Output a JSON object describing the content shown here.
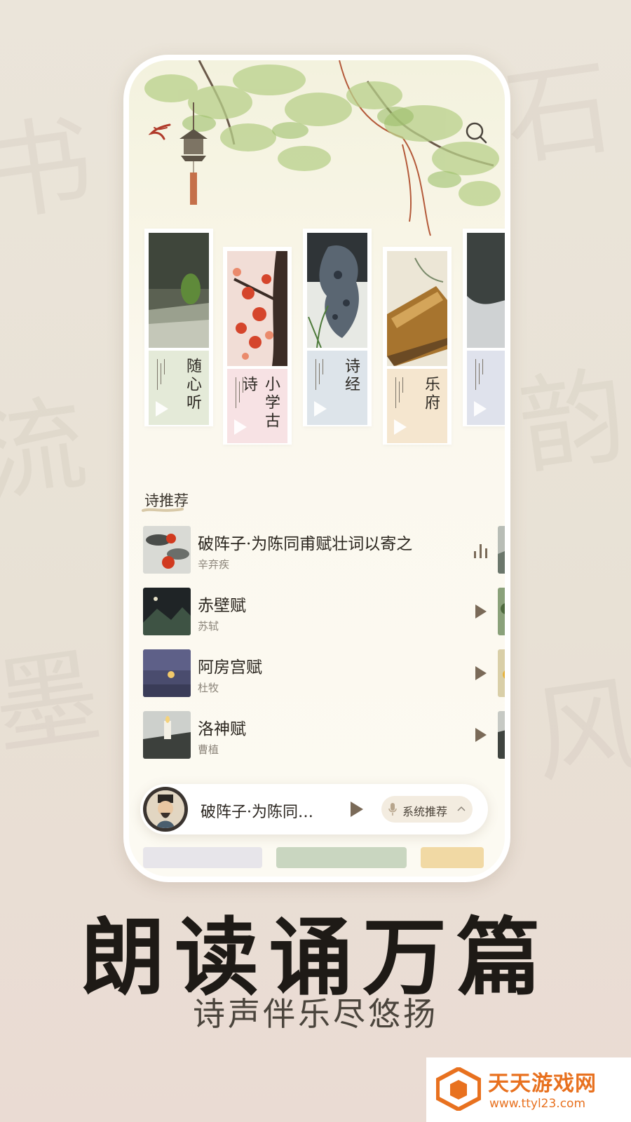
{
  "app": {
    "section_title": "诗推荐"
  },
  "categories": [
    {
      "title": "随心听",
      "tint": "#e4ead8",
      "image": "mossy-stone-steps"
    },
    {
      "title": "小学古诗",
      "tint": "#f7e2e4",
      "image": "red-maple-leaves"
    },
    {
      "title": "诗经",
      "tint": "#dde4ea",
      "image": "scholar-rock"
    },
    {
      "title": "乐府",
      "tint": "#f5e6cf",
      "image": "ancient-book"
    },
    {
      "title": "",
      "tint": "#dfe2ec",
      "image": "ink-landscape"
    }
  ],
  "recommendations": [
    {
      "title": "破阵子·为陈同甫赋壮词以寄之",
      "author": "辛弃疾",
      "state": "playing"
    },
    {
      "title": "赤壁赋",
      "author": "苏轼",
      "state": "paused"
    },
    {
      "title": "阿房宫赋",
      "author": "杜牧",
      "state": "paused"
    },
    {
      "title": "洛神赋",
      "author": "曹植",
      "state": "paused"
    }
  ],
  "player": {
    "title": "破阵子·为陈同…",
    "voice_label": "系统推荐"
  },
  "poster": {
    "headline": "朗读诵万篇",
    "subline": "诗声伴乐尽悠扬"
  },
  "watermark": {
    "name": "天天游戏网",
    "url": "www.ttyl23.com"
  },
  "colors": {
    "accent": "#7a6a58",
    "background": "#fbf8ee",
    "watermark": "#e8711f"
  }
}
